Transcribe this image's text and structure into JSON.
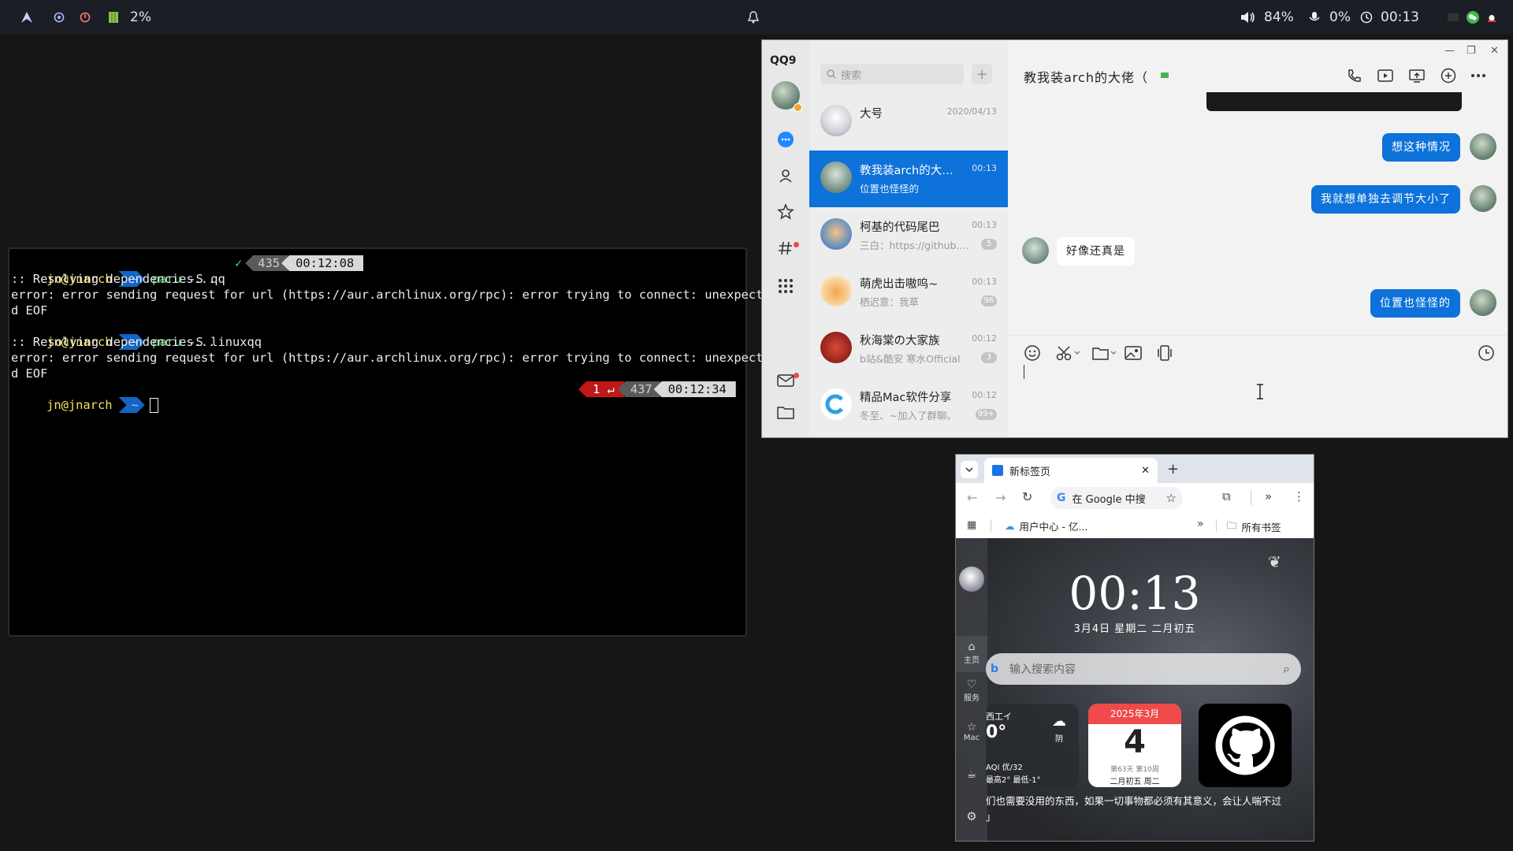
{
  "topbar": {
    "cpu_percent": "2%",
    "volume": "84%",
    "mic": "0%",
    "clock": "00:13"
  },
  "terminal": {
    "lines": [
      {
        "user": "jn@jnarch",
        "path": "~",
        "cmd": "paru",
        "args": " -S qq",
        "check": "✓",
        "num": "435",
        "time": "00:12:08"
      },
      {
        "text": ":: Resolving dependencies..."
      },
      {
        "text": "error: error sending request for url (https://aur.archlinux.org/rpc): error trying to connect: unexpecte"
      },
      {
        "text": "d EOF"
      },
      {
        "user": "jn@jnarch",
        "path": "~",
        "cmd": "paru",
        "args": " -S linuxqq"
      },
      {
        "text": ":: Resolving dependencies..."
      },
      {
        "text": "error: error sending request for url (https://aur.archlinux.org/rpc): error trying to connect: unexpecte"
      },
      {
        "text": "d EOF"
      },
      {
        "user": "jn@jnarch",
        "path": "~",
        "err": "1 ↵",
        "num": "437",
        "time": "00:12:34"
      }
    ]
  },
  "qq": {
    "logo": "QQ9",
    "search_placeholder": "搜索",
    "add": "+",
    "chats": [
      {
        "name": "大号",
        "time": "2020/04/13",
        "preview": "",
        "badge": ""
      },
      {
        "name": "教我装arch的大佬（",
        "time": "00:13",
        "preview": "位置也怪怪的",
        "badge": ""
      },
      {
        "name": "柯基的代码尾巴",
        "time": "00:13",
        "preview": "三白：https://github.com/",
        "badge": "5"
      },
      {
        "name": "萌虎出击嗷呜~",
        "time": "00:13",
        "preview": "栖迟意：我草",
        "badge": "96"
      },
      {
        "name": "秋海棠の大家族",
        "time": "00:12",
        "preview": "b站&酷安 寒水Official",
        "badge": "3"
      },
      {
        "name": "精品Mac软件分享",
        "time": "00:12",
        "preview": "冬至、~加入了群聊。",
        "badge": "99+"
      }
    ],
    "chat_title": "教我装arch的大佬（",
    "messages": [
      {
        "dir": "out",
        "text": "想这种情况"
      },
      {
        "dir": "out",
        "text": "我就想单独去调节大小了"
      },
      {
        "dir": "in",
        "text": "好像还真是"
      },
      {
        "dir": "out",
        "text": "位置也怪怪的"
      }
    ]
  },
  "chrome": {
    "tab_title": "新标签页",
    "omnibox": "在 Google 中搜",
    "bookmark": "用户中心 - 亿...",
    "all_bookmarks": "所有书签",
    "page": {
      "time": "00:13",
      "date": "3月4日  星期二  二月初五",
      "search_placeholder": "输入搜索内容",
      "rail": [
        "主页",
        "服务",
        "Mac"
      ],
      "weather": {
        "city": "西工イ",
        "temp": "0°",
        "cond": "阴",
        "aqi": "AQI 优/32",
        "range": "最高2° 最低-1°"
      },
      "calendar": {
        "month": "2025年3月",
        "day": "4",
        "sub": "第63天 第10周",
        "lunar": "二月初五 周二"
      },
      "quote_line1": "们也需要没用的东西，如果一切事物都必须有其意义，会让人喘不过",
      "quote_line2": "」"
    }
  }
}
